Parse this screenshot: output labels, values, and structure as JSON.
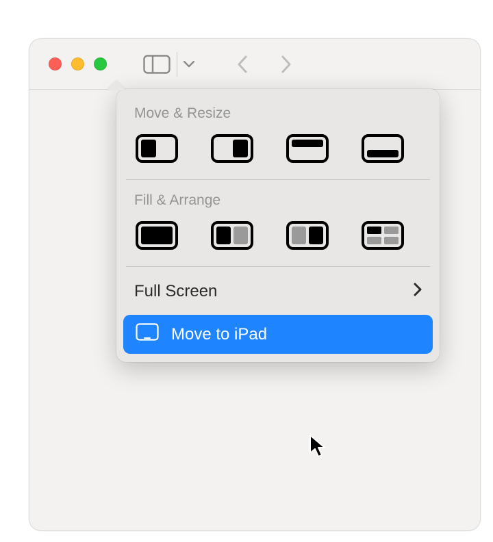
{
  "dropdown": {
    "move_resize_label": "Move & Resize",
    "fill_arrange_label": "Fill & Arrange",
    "full_screen_label": "Full Screen",
    "move_to_ipad_label": "Move to iPad"
  },
  "colors": {
    "highlight": "#1f84ff",
    "traffic_red": "#ff5f57",
    "traffic_yellow": "#febc2e",
    "traffic_green": "#28c840"
  }
}
